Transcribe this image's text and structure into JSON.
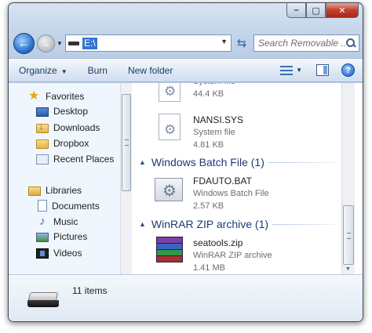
{
  "window": {
    "caption_min": "–",
    "caption_max": "▢",
    "caption_close": "✕"
  },
  "address": {
    "path": "E:\\",
    "search_placeholder": "Search Removable ..."
  },
  "toolbar": {
    "organize": "Organize",
    "burn": "Burn",
    "new_folder": "New folder",
    "help": "?"
  },
  "sidebar": {
    "favorites": "Favorites",
    "favorites_items": [
      "Desktop",
      "Downloads",
      "Dropbox",
      "Recent Places"
    ],
    "libraries": "Libraries",
    "libraries_items": [
      "Documents",
      "Music",
      "Pictures",
      "Videos"
    ]
  },
  "content": {
    "files": [
      {
        "name": "",
        "type": "System file",
        "size": "44.4 KB",
        "icon": "system-file-icon"
      },
      {
        "name": "NANSI.SYS",
        "type": "System file",
        "size": "4.81 KB",
        "icon": "system-file-icon"
      },
      {
        "name": "FDAUTO.BAT",
        "type": "Windows Batch File",
        "size": "2.57 KB",
        "icon": "batch-file-icon"
      },
      {
        "name": "seatools.zip",
        "type": "WinRAR ZIP archive",
        "size": "1.41 MB",
        "icon": "winrar-archive-icon"
      }
    ],
    "groups": [
      {
        "title": "Windows Batch File (1)"
      },
      {
        "title": "WinRAR ZIP archive (1)"
      }
    ]
  },
  "details": {
    "count": "11 items"
  }
}
